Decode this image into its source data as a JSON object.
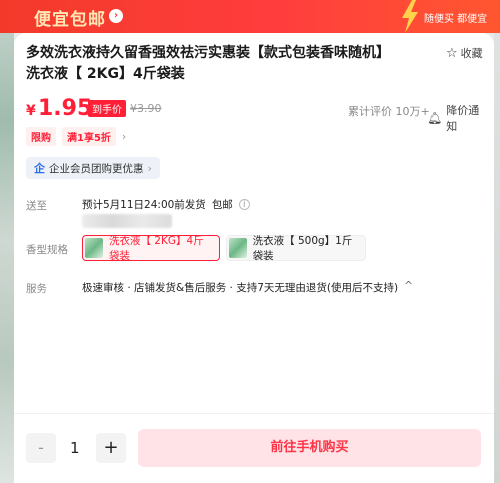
{
  "banner": {
    "title": "便宜包邮",
    "right_text": "随便买 都便宜"
  },
  "product": {
    "title": "多效洗衣液持久留香强效祛污实惠装【款式包装香味随机】 洗衣液【 2KG】4斤袋装",
    "favorite_label": "收藏"
  },
  "price": {
    "currency": "¥",
    "value": "1.95",
    "tag": "到手价",
    "original": "¥3.90",
    "reviews": "累计评价 10万+",
    "notify": "降价通知"
  },
  "tags": [
    "限购",
    "满1享5折"
  ],
  "promo": {
    "icon": "企",
    "text": "企业会员团购更优惠"
  },
  "shipping": {
    "label": "送至",
    "estimate": "预计5月11日24:00前发货",
    "free": "包邮"
  },
  "variants": {
    "label": "香型规格",
    "options": [
      {
        "text": "洗衣液【 2KG】4斤袋装",
        "selected": true
      },
      {
        "text": "洗衣液【 500g】1斤袋装",
        "selected": false
      }
    ]
  },
  "service": {
    "label": "服务",
    "text": "极速审核 · 店铺发货&售后服务 · 支持7天无理由退货(使用后不支持)"
  },
  "purchase": {
    "minus": "-",
    "quantity": "1",
    "plus": "+",
    "buy_label": "前往手机购买"
  },
  "colors": {
    "accent": "#ff1f36",
    "banner": "#ff3d3d",
    "buy_bg": "#ffe3e6"
  },
  "icons": [
    "chevron-right-icon",
    "star-icon",
    "bell-icon",
    "info-icon",
    "chevron-up-icon",
    "enterprise-icon",
    "lightning-icon"
  ]
}
